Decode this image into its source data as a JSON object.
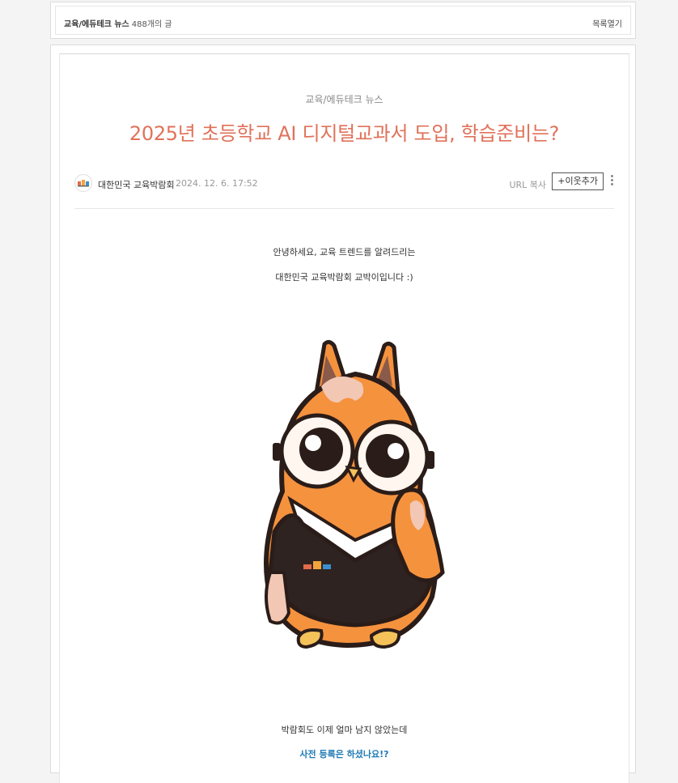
{
  "list_bar": {
    "category": "교육/에듀테크 뉴스",
    "count": "488개의 글",
    "open_list": "목록열기"
  },
  "post": {
    "category": "교육/에듀테크 뉴스",
    "title": "2025년 초등학교 AI 디지털교과서 도입, 학습준비는?",
    "author": "대한민국 교육박람회",
    "date": "2024. 12. 6. 17:52",
    "url_copy": "URL 복사",
    "add_neighbor": "+이웃추가",
    "paragraphs": [
      "안녕하세요, 교육 트렌드를 알려드리는",
      "대한민국 교육박람회 교박이입니다 :)",
      "박람회도 이제 얼마 남지 않았는데",
      "사전 등록은 하셨나요!?"
    ]
  },
  "colors": {
    "title": "#e0725a",
    "link": "#1f7ab5",
    "mascot_orange": "#f5923e"
  },
  "icons": {
    "avatar": "expo-logo-icon",
    "more": "more-vertical-icon"
  }
}
